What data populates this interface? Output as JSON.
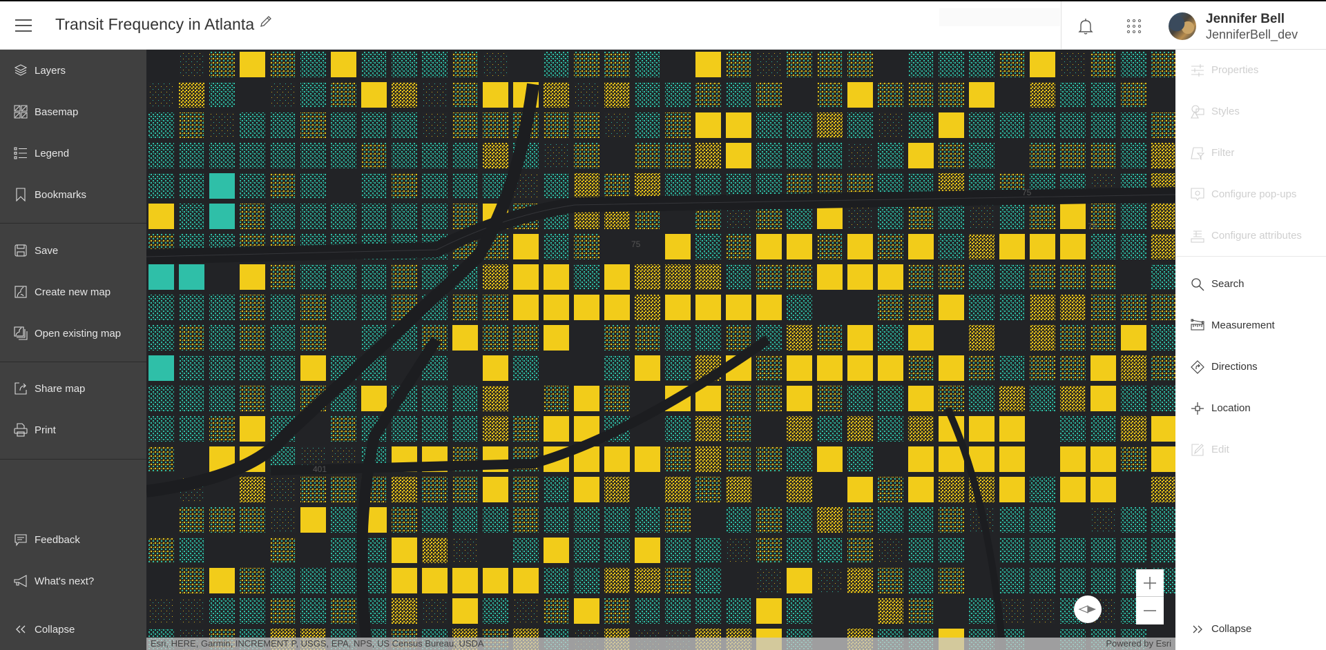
{
  "header": {
    "title": "Transit Frequency in Atlanta",
    "menu_icon": "hamburger-menu-icon",
    "edit_icon": "pencil-icon",
    "notifications_icon": "bell-icon",
    "apps_icon": "app-launcher-grid-icon",
    "user": {
      "name": "Jennifer Bell",
      "username": "JenniferBell_dev"
    }
  },
  "left_sidebar": {
    "groups": [
      [
        {
          "label": "Layers",
          "icon": "layers-icon"
        },
        {
          "label": "Basemap",
          "icon": "basemap-icon"
        },
        {
          "label": "Legend",
          "icon": "legend-icon"
        },
        {
          "label": "Bookmarks",
          "icon": "bookmark-icon"
        }
      ],
      [
        {
          "label": "Save",
          "icon": "save-icon"
        },
        {
          "label": "Create new map",
          "icon": "create-map-icon"
        },
        {
          "label": "Open existing map",
          "icon": "open-map-icon"
        }
      ],
      [
        {
          "label": "Share map",
          "icon": "share-icon"
        },
        {
          "label": "Print",
          "icon": "print-icon"
        }
      ]
    ],
    "footer": [
      {
        "label": "Feedback",
        "icon": "feedback-icon"
      },
      {
        "label": "What's next?",
        "icon": "megaphone-icon"
      },
      {
        "label": "Collapse",
        "icon": "chevrons-left-icon"
      }
    ]
  },
  "right_sidebar": {
    "layer_tools": [
      {
        "label": "Properties",
        "icon": "sliders-icon",
        "enabled": false
      },
      {
        "label": "Styles",
        "icon": "styles-icon",
        "enabled": false
      },
      {
        "label": "Filter",
        "icon": "filter-icon",
        "enabled": false
      },
      {
        "label": "Configure pop-ups",
        "icon": "popup-icon",
        "enabled": false
      },
      {
        "label": "Configure attributes",
        "icon": "attributes-icon",
        "enabled": false
      }
    ],
    "map_tools": [
      {
        "label": "Search",
        "icon": "search-icon",
        "enabled": true
      },
      {
        "label": "Measurement",
        "icon": "measure-icon",
        "enabled": true
      },
      {
        "label": "Directions",
        "icon": "directions-icon",
        "enabled": true
      },
      {
        "label": "Location",
        "icon": "location-icon",
        "enabled": true
      },
      {
        "label": "Edit",
        "icon": "edit-icon",
        "enabled": false
      }
    ],
    "collapse": {
      "label": "Collapse",
      "icon": "chevrons-right-icon"
    }
  },
  "map": {
    "road_labels": [
      "75",
      "75",
      "75",
      "401"
    ],
    "colors": {
      "background": "#222326",
      "road": "#2e2f33",
      "teal": "#2fbfa8",
      "yellow": "#f2cc1a"
    },
    "zoom_in_label": "+",
    "zoom_out_label": "−",
    "attribution": "Esri, HERE, Garmin, INCREMENT P, USGS, EPA, NPS, US Census Bureau, USDA",
    "powered_by": "Powered by Esri"
  }
}
